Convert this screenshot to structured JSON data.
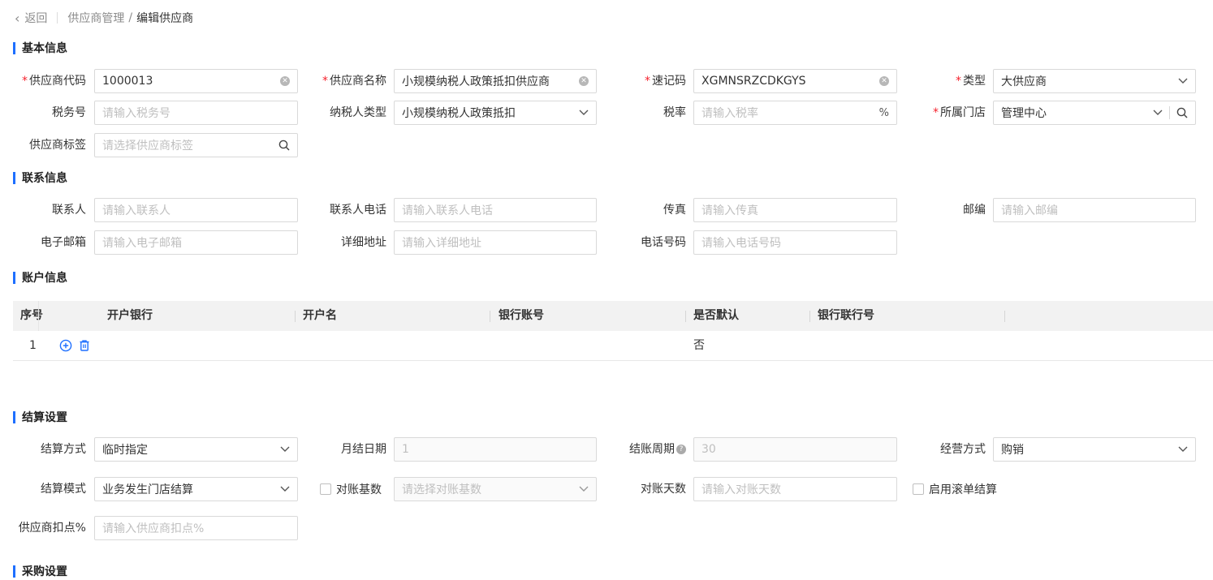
{
  "breadcrumb": {
    "back_label": "返回",
    "parent": "供应商管理",
    "current": "编辑供应商"
  },
  "sections": {
    "basic": "基本信息",
    "contact": "联系信息",
    "account": "账户信息",
    "settlement": "结算设置",
    "purchase": "采购设置"
  },
  "basic": {
    "supplier_code": {
      "label": "供应商代码",
      "value": "1000013",
      "required": true
    },
    "supplier_name": {
      "label": "供应商名称",
      "value": "小规模纳税人政策抵扣供应商",
      "required": true
    },
    "quick_code": {
      "label": "速记码",
      "value": "XGMNSRZCDKGYS",
      "required": true
    },
    "type": {
      "label": "类型",
      "value": "大供应商",
      "required": true
    },
    "tax_no": {
      "label": "税务号",
      "placeholder": "请输入税务号"
    },
    "taxpayer_type": {
      "label": "纳税人类型",
      "value": "小规模纳税人政策抵扣"
    },
    "tax_rate": {
      "label": "税率",
      "placeholder": "请输入税率",
      "suffix": "%"
    },
    "store": {
      "label": "所属门店",
      "value": "管理中心",
      "required": true
    },
    "supplier_tag": {
      "label": "供应商标签",
      "placeholder": "请选择供应商标签"
    }
  },
  "contact": {
    "contact_person": {
      "label": "联系人",
      "placeholder": "请输入联系人"
    },
    "contact_phone": {
      "label": "联系人电话",
      "placeholder": "请输入联系人电话"
    },
    "fax": {
      "label": "传真",
      "placeholder": "请输入传真"
    },
    "postcode": {
      "label": "邮编",
      "placeholder": "请输入邮编"
    },
    "email": {
      "label": "电子邮箱",
      "placeholder": "请输入电子邮箱"
    },
    "address": {
      "label": "详细地址",
      "placeholder": "请输入详细地址"
    },
    "telephone": {
      "label": "电话号码",
      "placeholder": "请输入电话号码"
    }
  },
  "account_table": {
    "columns": [
      "序号",
      "开户银行",
      "开户名",
      "银行账号",
      "是否默认",
      "银行联行号"
    ],
    "rows": [
      {
        "seq": "1",
        "is_default": "否"
      }
    ]
  },
  "settlement": {
    "method": {
      "label": "结算方式",
      "value": "临时指定"
    },
    "month_day": {
      "label": "月结日期",
      "value": "1"
    },
    "cycle": {
      "label": "结账周期",
      "value": "30"
    },
    "business_mode": {
      "label": "经营方式",
      "value": "购销"
    },
    "mode": {
      "label": "结算模式",
      "value": "业务发生门店结算"
    },
    "recon_base": {
      "label": "对账基数",
      "placeholder": "请选择对账基数"
    },
    "recon_days": {
      "label": "对账天数",
      "placeholder": "请输入对账天数"
    },
    "rolling": {
      "label": "启用滚单结算"
    },
    "discount": {
      "label": "供应商扣点%",
      "placeholder": "请输入供应商扣点%"
    }
  },
  "colors": {
    "accent": "#1e6fff",
    "required": "#f5222d"
  }
}
